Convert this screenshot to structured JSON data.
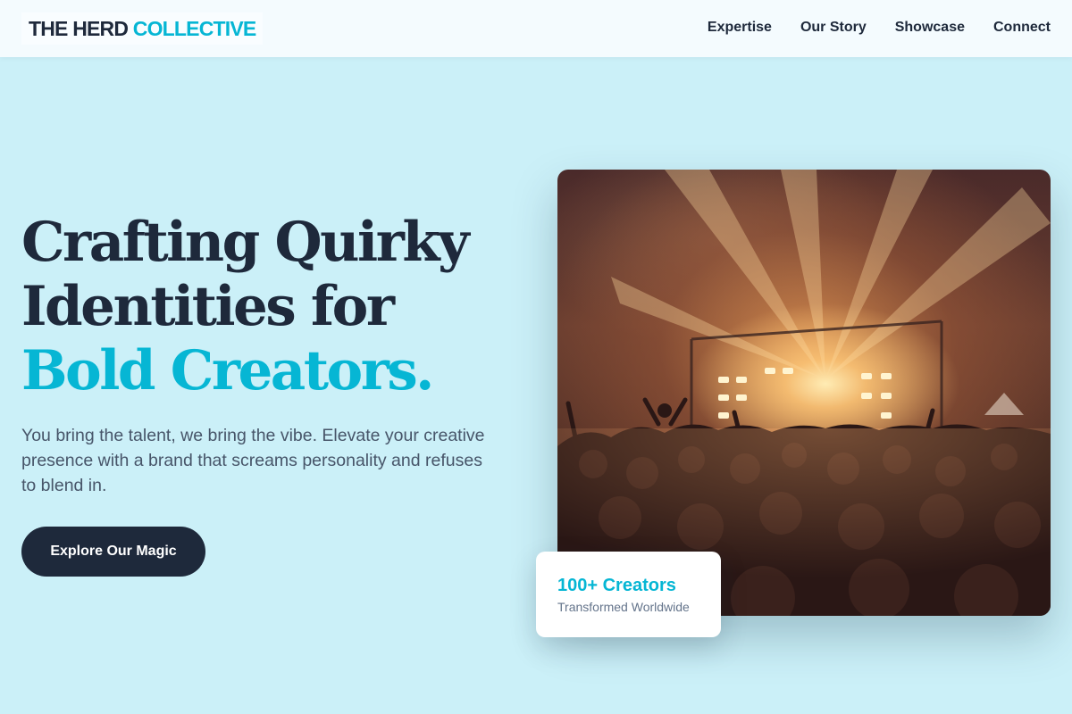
{
  "header": {
    "logo_part1": "THE HERD",
    "logo_part2": "COLLECTIVE",
    "nav": [
      "Expertise",
      "Our Story",
      "Showcase",
      "Connect"
    ]
  },
  "hero": {
    "title_line1": "Crafting Quirky",
    "title_line2": "Identities for",
    "title_accent": "Bold Creators.",
    "subtitle": "You bring the talent, we bring the vibe. Elevate your creative presence with a brand that screams personality and refuses to blend in.",
    "cta_label": "Explore Our Magic"
  },
  "stat_card": {
    "value": "100+ Creators",
    "label": "Transformed Worldwide"
  },
  "colors": {
    "background": "#cbf0f8",
    "text_dark": "#1e293b",
    "accent": "#06b6d4",
    "muted": "#475569"
  }
}
